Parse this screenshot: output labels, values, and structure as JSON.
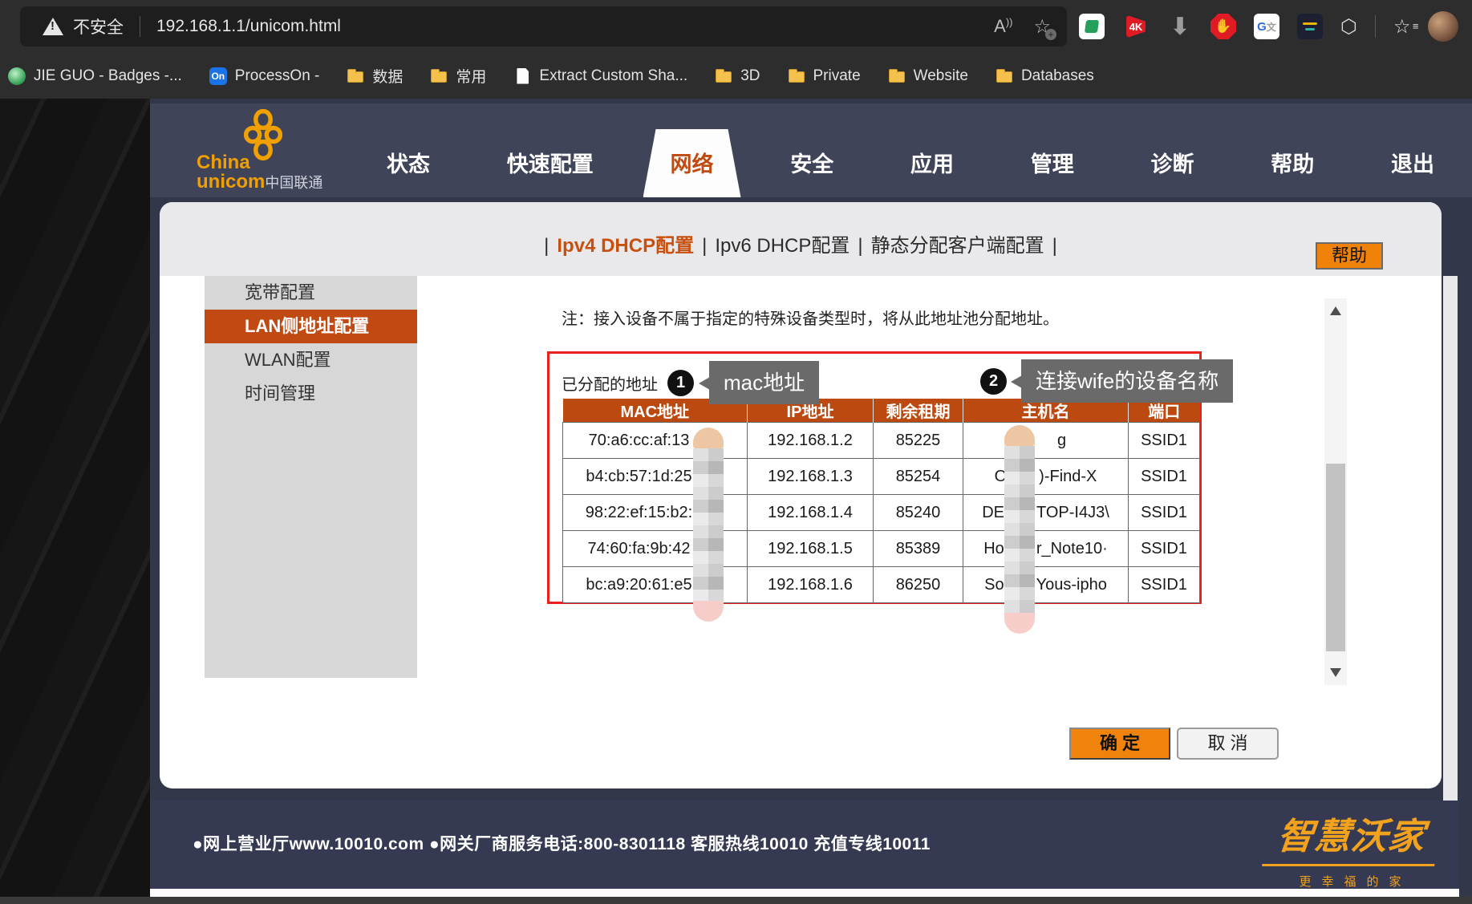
{
  "colors": {
    "accent_orange": "#f0820a",
    "selected_orange": "#c04a12",
    "table_header": "#bc4a10",
    "annotation_red": "#e8211d",
    "header_navy": "#404459",
    "footer_navy": "#353a52"
  },
  "browser": {
    "security_label": "不安全",
    "url": "192.168.1.1/unicom.html",
    "bookmarks": [
      {
        "icon": "badge",
        "label": "JIE GUO - Badges -..."
      },
      {
        "icon": "processon",
        "label": "ProcessOn -",
        "badge_text": "On"
      },
      {
        "icon": "folder",
        "label": "数据"
      },
      {
        "icon": "folder",
        "label": "常用"
      },
      {
        "icon": "file",
        "label": "Extract Custom Sha..."
      },
      {
        "icon": "folder",
        "label": "3D"
      },
      {
        "icon": "folder",
        "label": "Private"
      },
      {
        "icon": "folder",
        "label": "Website"
      },
      {
        "icon": "folder",
        "label": "Databases"
      }
    ],
    "extensions": [
      "doc-green",
      "4k",
      "down-arrow",
      "stop-hand",
      "translate",
      "dark"
    ],
    "ext_4k_label": "4K"
  },
  "header": {
    "logo_line1": "China",
    "logo_line2": "unicom",
    "logo_cn": "中国联通",
    "tabs": [
      {
        "label": "状态",
        "active": false
      },
      {
        "label": "快速配置",
        "active": false
      },
      {
        "label": "网络",
        "active": true
      },
      {
        "label": "安全",
        "active": false
      },
      {
        "label": "应用",
        "active": false
      },
      {
        "label": "管理",
        "active": false
      },
      {
        "label": "诊断",
        "active": false
      },
      {
        "label": "帮助",
        "active": false
      },
      {
        "label": "退出",
        "active": false
      }
    ]
  },
  "subnav": {
    "items": [
      {
        "label": "Ipv4 DHCP配置",
        "active": true
      },
      {
        "label": "Ipv6 DHCP配置",
        "active": false
      },
      {
        "label": "静态分配客户端配置",
        "active": false
      }
    ],
    "separator": "|"
  },
  "help_button": "帮助",
  "sidebar": {
    "items": [
      {
        "label": "宽带配置",
        "active": false
      },
      {
        "label": "LAN侧地址配置",
        "active": true
      },
      {
        "label": "WLAN配置",
        "active": false
      },
      {
        "label": "时间管理",
        "active": false
      }
    ]
  },
  "content": {
    "note": "注：接入设备不属于指定的特殊设备类型时，将从此地址池分配地址。",
    "table_title": "已分配的地址",
    "annotations": [
      {
        "number": "1",
        "tooltip": "mac地址"
      },
      {
        "number": "2",
        "tooltip": "连接wife的设备名称"
      }
    ],
    "table": {
      "headers": [
        "MAC地址",
        "IP地址",
        "剩余租期",
        "主机名",
        "端口"
      ],
      "rows": [
        {
          "mac": "70:a6:cc:af:13",
          "ip": "192.168.1.2",
          "lease": "85225",
          "host_prefix": "",
          "host_suffix": "g",
          "port": "SSID1"
        },
        {
          "mac": "b4:cb:57:1d:25",
          "ip": "192.168.1.3",
          "lease": "85254",
          "host_prefix": "O",
          "host_suffix": ")-Find-X",
          "port": "SSID1"
        },
        {
          "mac": "98:22:ef:15:b2:",
          "ip": "192.168.1.4",
          "lease": "85240",
          "host_prefix": "DE",
          "host_suffix": "TOP-I4J3\\",
          "port": "SSID1"
        },
        {
          "mac": "74:60:fa:9b:42",
          "ip": "192.168.1.5",
          "lease": "85389",
          "host_prefix": "Ho",
          "host_suffix": "r_Note10·",
          "port": "SSID1"
        },
        {
          "mac": "bc:a9:20:61:e5",
          "ip": "192.168.1.6",
          "lease": "86250",
          "host_prefix": "So",
          "host_suffix": "Yous-ipho",
          "port": "SSID1"
        }
      ]
    },
    "ok_button": "确 定",
    "cancel_button": "取 消"
  },
  "footer": {
    "info_line": "●网上营业厅www.10010.com ●网关厂商服务电话:800-8301118 客服热线10010 充值专线10011",
    "logo_main": "智慧沃家",
    "logo_sub": "更幸福的家"
  }
}
